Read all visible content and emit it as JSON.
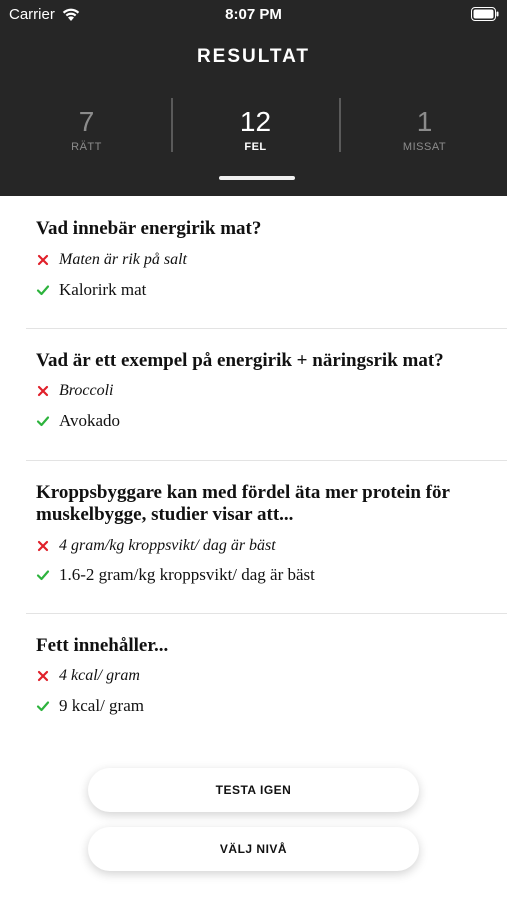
{
  "status_bar": {
    "carrier": "Carrier",
    "time": "8:07 PM"
  },
  "header": {
    "title": "RESULTAT"
  },
  "stats": [
    {
      "value": "7",
      "label": "RÄTT"
    },
    {
      "value": "12",
      "label": "FEL"
    },
    {
      "value": "1",
      "label": "MISSAT"
    }
  ],
  "questions": [
    {
      "question": "Vad innebär energirik mat?",
      "wrong": "Maten är rik på salt",
      "correct": "Kalorirk mat"
    },
    {
      "question": "Vad är ett exempel på energirik + näringsrik mat?",
      "wrong": "Broccoli",
      "correct": "Avokado"
    },
    {
      "question": "Kroppsbyggare kan med fördel äta mer protein för muskelbygge, studier visar att...",
      "wrong": "4 gram/kg kroppsvikt/ dag är bäst",
      "correct": "1.6-2 gram/kg kroppsvikt/ dag är bäst"
    },
    {
      "question": "Fett innehåller...",
      "wrong": "4 kcal/ gram",
      "correct": "9 kcal/ gram"
    }
  ],
  "buttons": {
    "retry": "TESTA IGEN",
    "choose_level": "VÄLJ NIVÅ"
  },
  "colors": {
    "header_bg": "#262626",
    "wrong": "#e0202a",
    "correct": "#2db33d"
  }
}
